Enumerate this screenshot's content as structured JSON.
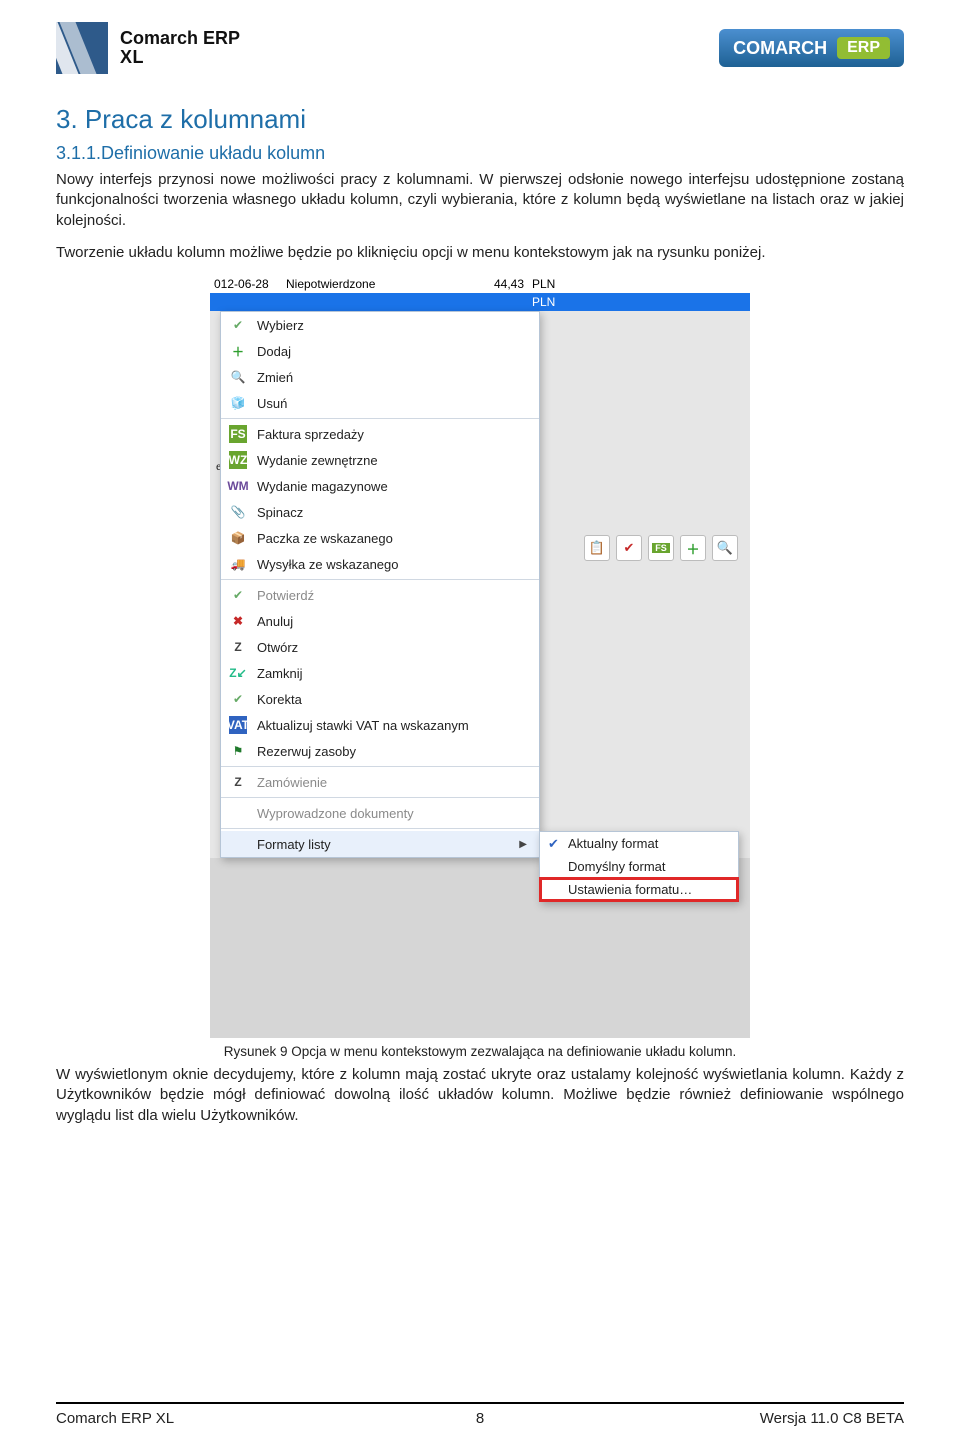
{
  "header": {
    "brand_line1": "Comarch ERP",
    "brand_line2": "XL",
    "badge_brand": "COMARCH",
    "badge_tag": "ERP"
  },
  "doc": {
    "h1": "3.  Praca z kolumnami",
    "h2": "3.1.1.Definiowanie układu kolumn",
    "p1": "Nowy interfejs przynosi nowe możliwości pracy z kolumnami. W pierwszej odsłonie nowego interfejsu udostępnione zostaną funkcjonalności tworzenia własnego układu kolumn, czyli wybierania, które z kolumn będą wyświetlane na listach oraz w jakiej kolejności.",
    "p2": "Tworzenie układu kolumn możliwe będzie po kliknięciu opcji w menu kontekstowym jak na rysunku poniżej.",
    "caption": "Rysunek 9 Opcja w menu kontekstowym zezwalająca na definiowanie układu kolumn.",
    "p3": "W wyświetlonym oknie decydujemy, które z kolumn mają zostać ukryte oraz ustalamy kolejność wyświetlania kolumn. Każdy z Użytkowników będzie mógł definiować dowolną ilość układów kolumn. Możliwe będzie również definiowanie wspólnego wyglądu list dla wielu Użytkowników."
  },
  "grid": {
    "r1_date": "012-06-28",
    "r1_status": "Niepotwierdzone",
    "r1_num": "44,43",
    "r1_cur": "PLN",
    "r2_cur": "PLN",
    "side_label": "ech"
  },
  "menu": {
    "items": [
      {
        "label": "Wybierz",
        "icon": "check"
      },
      {
        "label": "Dodaj",
        "icon": "plus"
      },
      {
        "label": "Zmień",
        "icon": "lens"
      },
      {
        "label": "Usuń",
        "icon": "del"
      },
      {
        "sep": true
      },
      {
        "label": "Faktura sprzedaży",
        "icon": "fs"
      },
      {
        "label": "Wydanie zewnętrzne",
        "icon": "wz"
      },
      {
        "label": "Wydanie magazynowe",
        "icon": "wm"
      },
      {
        "label": "Spinacz",
        "icon": "clip"
      },
      {
        "label": "Paczka ze wskazanego",
        "icon": "box"
      },
      {
        "label": "Wysyłka ze wskazanego",
        "icon": "ship"
      },
      {
        "sep": true
      },
      {
        "label": "Potwierdź",
        "icon": "check",
        "disabled": true
      },
      {
        "label": "Anuluj",
        "icon": "x"
      },
      {
        "label": "Otwórz",
        "icon": "z"
      },
      {
        "label": "Zamknij",
        "icon": "zc"
      },
      {
        "label": "Korekta",
        "icon": "check"
      },
      {
        "label": "Aktualizuj stawki VAT na wskazanym",
        "icon": "vat"
      },
      {
        "label": "Rezerwuj zasoby",
        "icon": "flag"
      },
      {
        "sep": true
      },
      {
        "label": "Zamówienie",
        "icon": "z",
        "disabled": true
      },
      {
        "sep": true
      },
      {
        "label": "Wyprowadzone dokumenty",
        "icon": "",
        "disabled": true
      },
      {
        "sep": true
      },
      {
        "label": "Formaty listy",
        "icon": "",
        "submenu": true,
        "hover": true
      }
    ],
    "submenu": [
      {
        "label": "Aktualny format",
        "checked": true
      },
      {
        "label": "Domyślny format"
      },
      {
        "label": "Ustawienia formatu…",
        "callout": true
      }
    ]
  },
  "toolbar": {
    "btns": [
      "paste",
      "check",
      "fs",
      "plus",
      "lens"
    ]
  },
  "footer": {
    "left": "Comarch ERP XL",
    "page": "8",
    "right": "Wersja 11.0 C8 BETA"
  }
}
